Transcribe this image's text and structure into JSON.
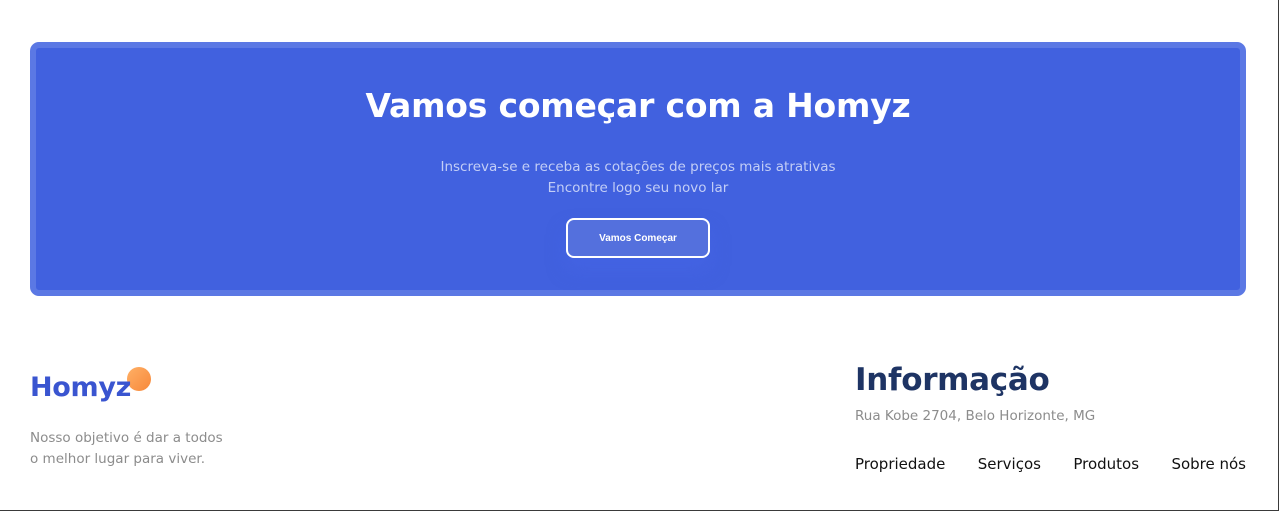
{
  "cta": {
    "title": "Vamos começar com a Homyz",
    "subtitle_line1": "Inscreva-se e receba as cotações de preços mais atrativas",
    "subtitle_line2": "Encontre logo seu novo lar",
    "button_label": "Vamos Começar"
  },
  "footer": {
    "brand": "Homyz",
    "tagline_line1": "Nosso objetivo é dar a todos",
    "tagline_line2": "o melhor lugar para viver.",
    "info_title": "Informação",
    "address": "Rua Kobe 2704, Belo Horizonte, MG",
    "nav": [
      "Propriedade",
      "Serviços",
      "Produtos",
      "Sobre nós"
    ]
  },
  "colors": {
    "cta_background": "#4161df",
    "brand_blue": "#3a55d0",
    "brand_orange": "#f7883a",
    "heading_navy": "#1e3464"
  }
}
